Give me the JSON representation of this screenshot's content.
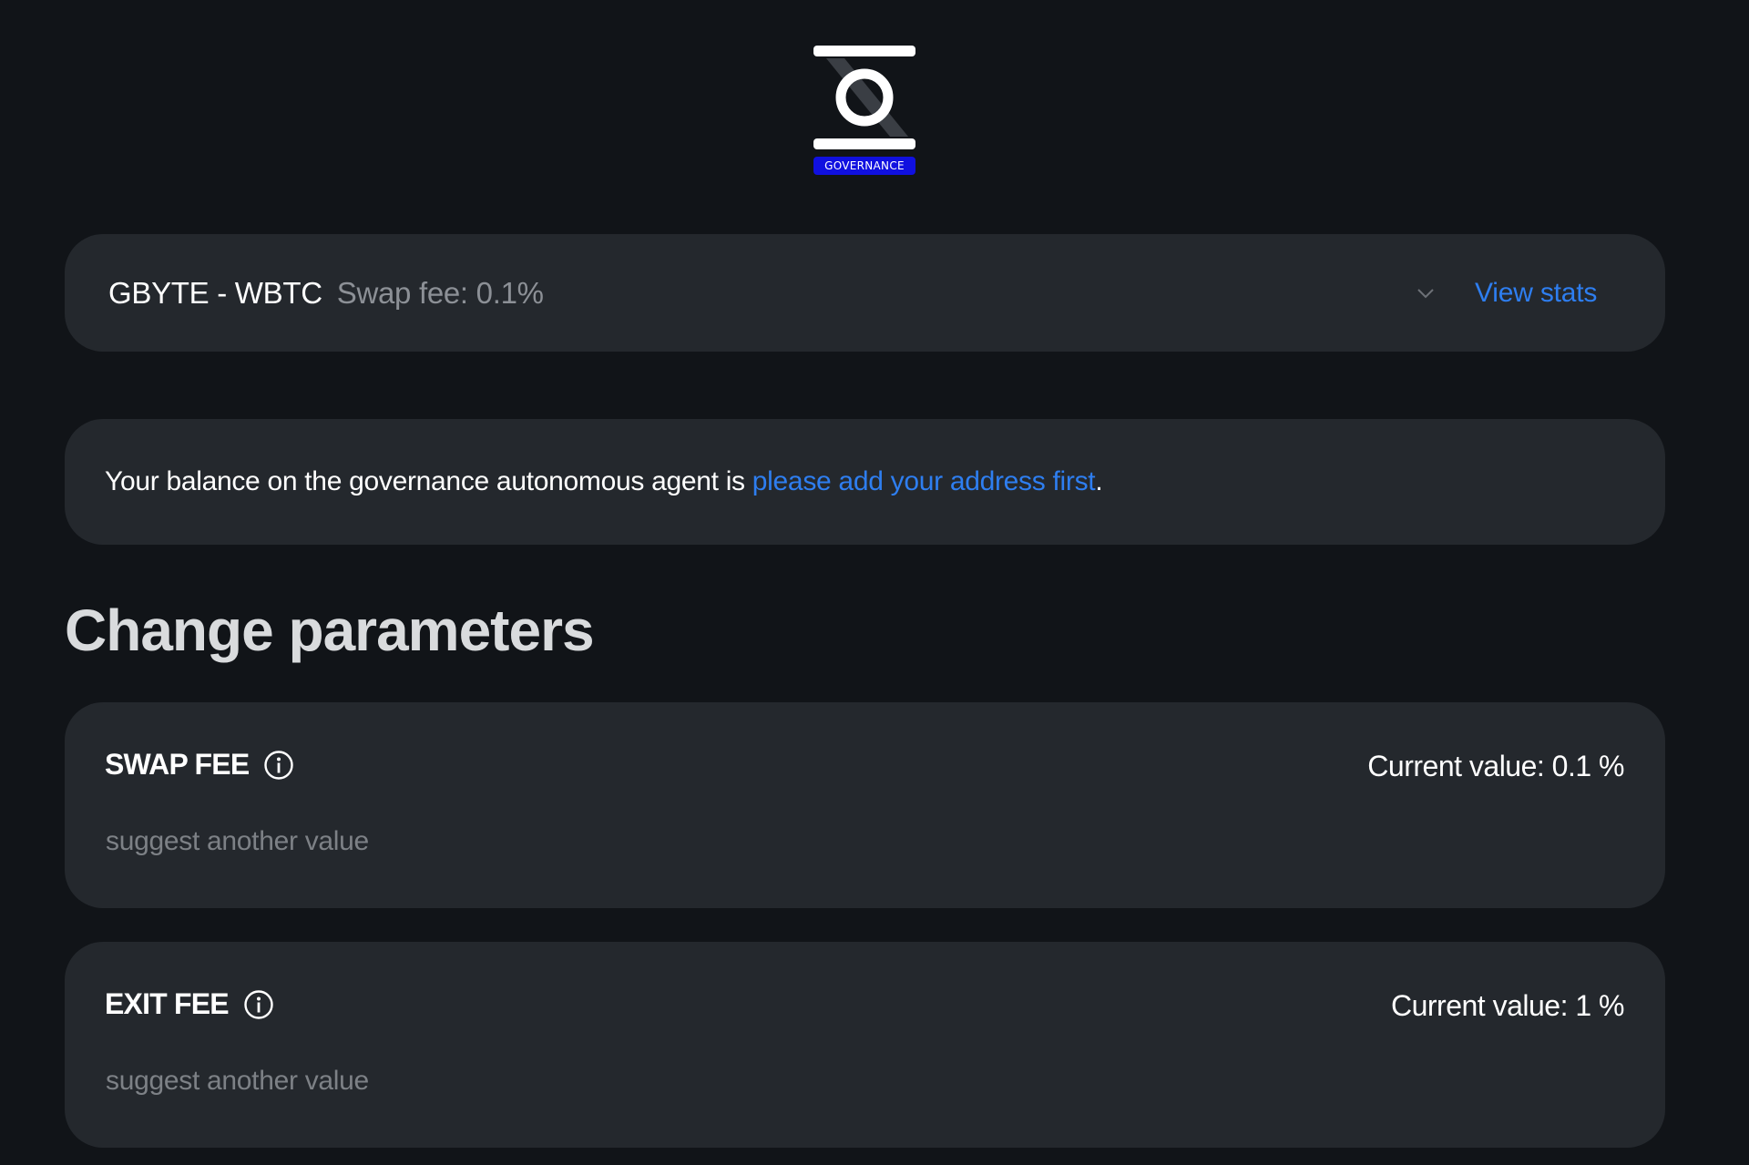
{
  "logo": {
    "badge_text": "GOVERNANCE",
    "icon": "governance-logo-icon",
    "badge_color": "#1010e0"
  },
  "pool_selector": {
    "pair": "GBYTE - WBTC",
    "fee_text": "Swap fee: 0.1%",
    "dropdown_icon": "chevron-down-icon",
    "view_stats_label": "View stats"
  },
  "balance": {
    "prefix": "Your balance on the governance autonomous agent is ",
    "link_text": "please add your address first",
    "suffix": "."
  },
  "section": {
    "title": "Change parameters"
  },
  "params": [
    {
      "name": "SWAP FEE",
      "info_icon": "info-icon",
      "current_value": "Current value: 0.1 %",
      "suggest_label": "suggest another value"
    },
    {
      "name": "EXIT FEE",
      "info_icon": "info-icon",
      "current_value": "Current value: 1 %",
      "suggest_label": "suggest another value"
    }
  ],
  "colors": {
    "background": "#111418",
    "card": "#24282d",
    "link": "#2e7ef0",
    "muted_text": "#8c9096"
  }
}
